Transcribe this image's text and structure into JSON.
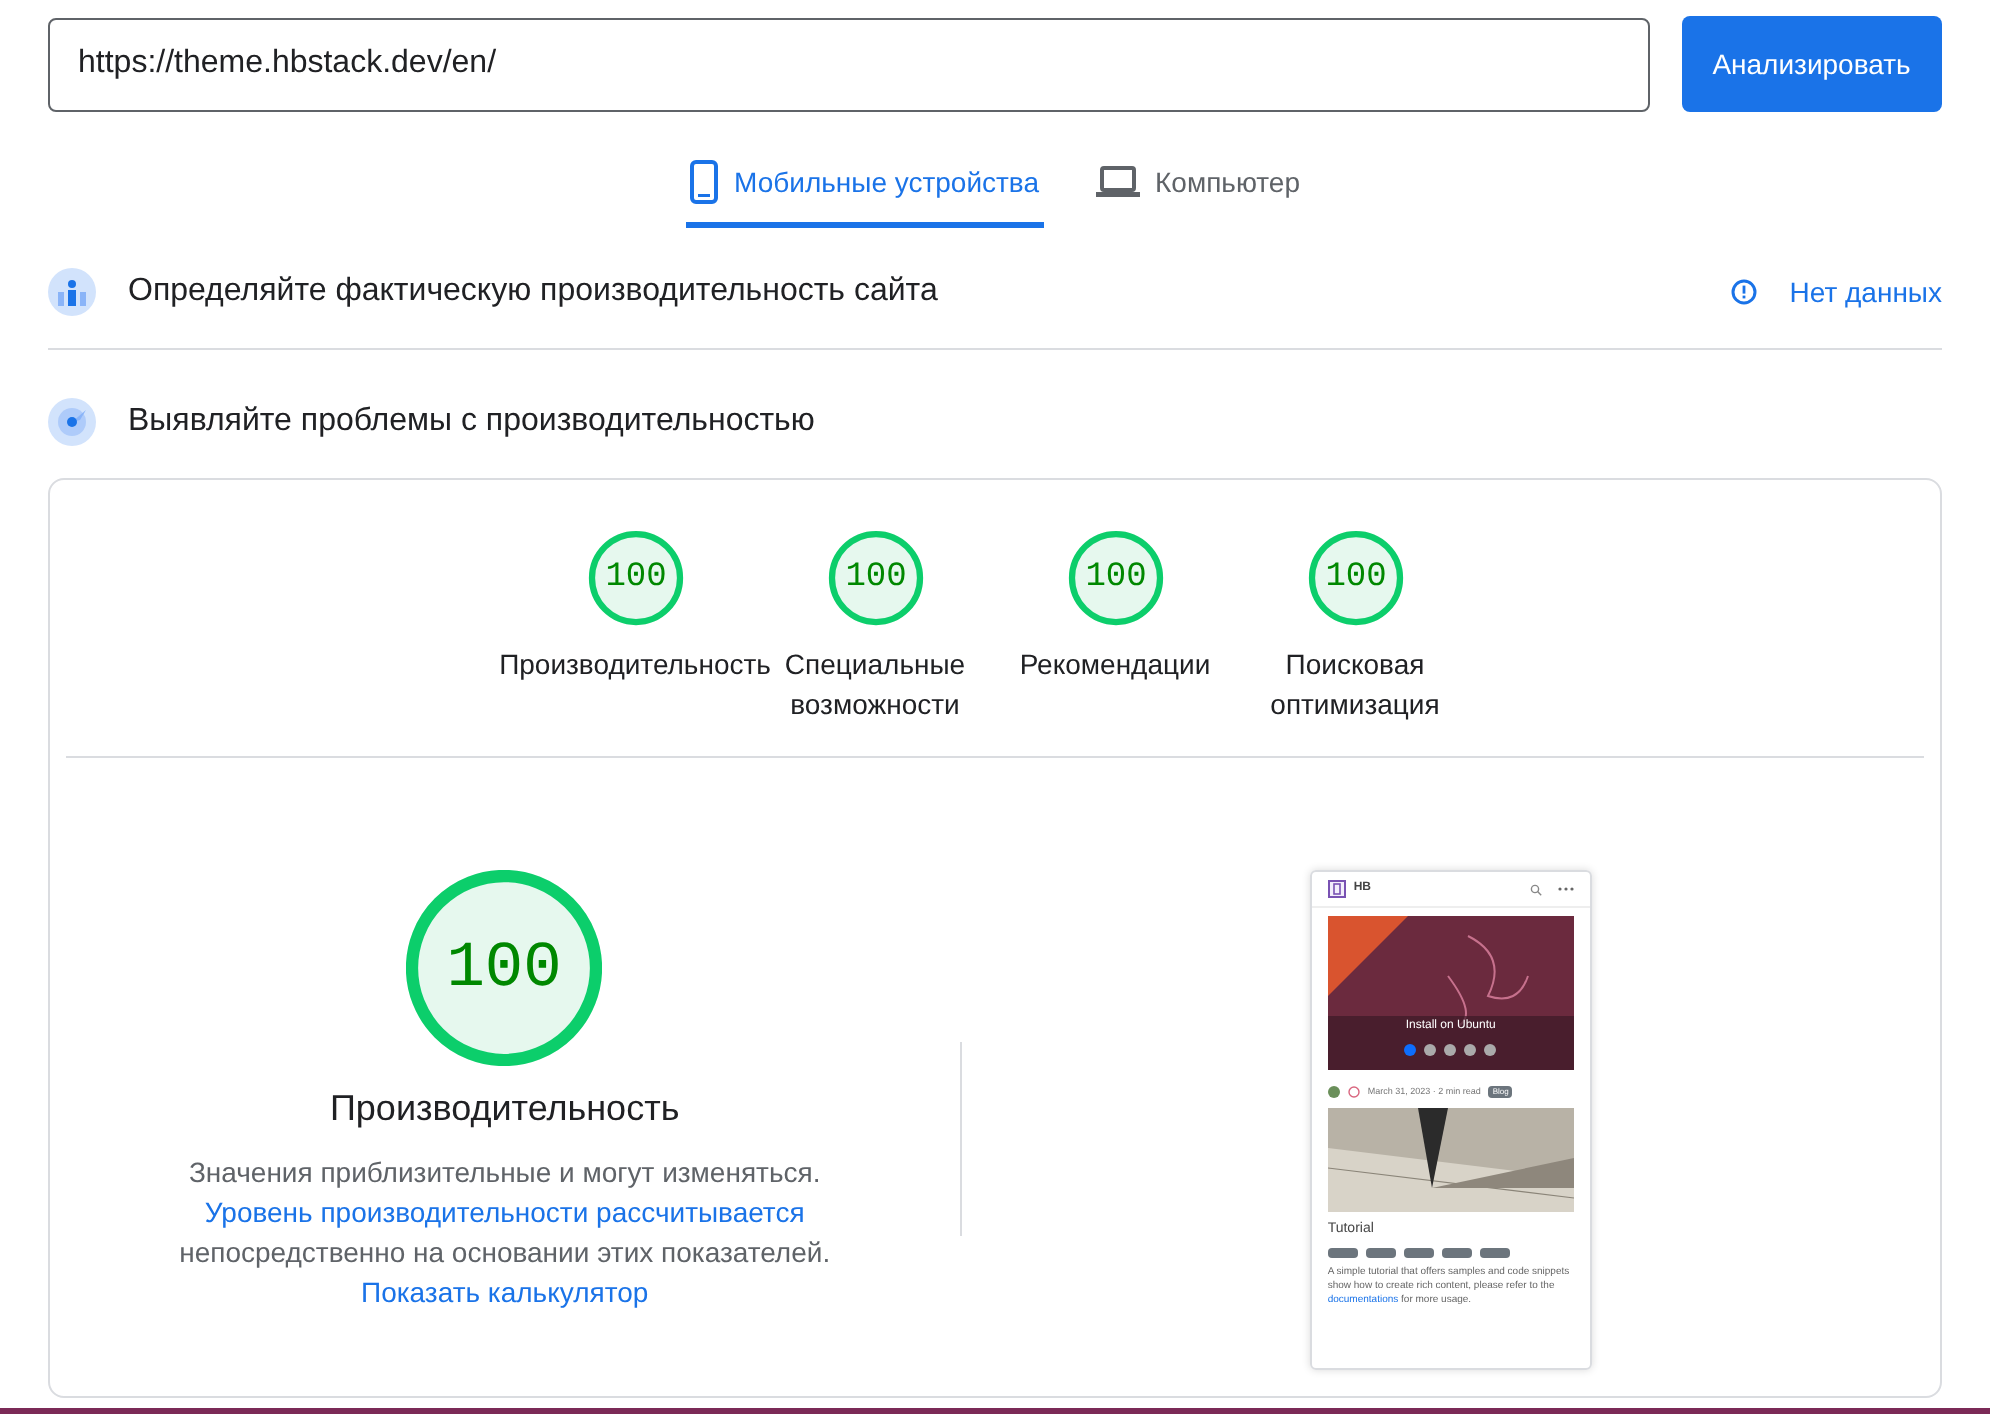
{
  "url_field": {
    "value": "https://theme.hbstack.dev/en/"
  },
  "analyze_button": "Анализировать",
  "device_tabs": [
    {
      "label": "Мобильные устройства",
      "kind": "phone",
      "selected": true
    },
    {
      "label": "Компьютер",
      "kind": "laptop",
      "selected": false
    }
  ],
  "field_data": {
    "title": "Определяйте фактическую производительность сайта",
    "status": "Нет данных"
  },
  "lab_data": {
    "title": "Выявляйте проблемы с производительностью"
  },
  "categories": [
    {
      "score": "100",
      "level": 1,
      "label": "Производительность"
    },
    {
      "score": "100",
      "level": 1,
      "label": "Специальные возможности"
    },
    {
      "score": "100",
      "level": 1,
      "label": "Рекомендации"
    },
    {
      "score": "100",
      "level": 1,
      "label": "Поисковая оптимизация"
    }
  ],
  "performance": {
    "score": "100",
    "level": 1,
    "title": "Производительность",
    "description": [
      {
        "kind": "text",
        "text": "Значения приблизительные и могут изменяться. "
      },
      {
        "kind": "link",
        "text": "Уровень производительности рассчитывается"
      },
      {
        "kind": "text",
        "text": " непосредственно на основании этих показателей. "
      },
      {
        "kind": "link",
        "text": "Показать калькулятор"
      }
    ]
  },
  "preview": {
    "brand": "HB",
    "slide_caption": "Install on Ubuntu",
    "slide_dots": [
      {
        "selected": true
      },
      {
        "selected": false
      },
      {
        "selected": false
      },
      {
        "selected": false
      },
      {
        "selected": false
      }
    ],
    "post_meta": "March 31, 2023 · 2 min read",
    "post_badge": "Blog",
    "post_title": "Tutorial",
    "summary": [
      {
        "kind": "text",
        "text": "A simple tutorial that offers samples and code snippets show how to create rich content, please refer to the "
      },
      {
        "kind": "link",
        "text": "documentations"
      },
      {
        "kind": "text",
        "text": " for more usage."
      }
    ]
  }
}
